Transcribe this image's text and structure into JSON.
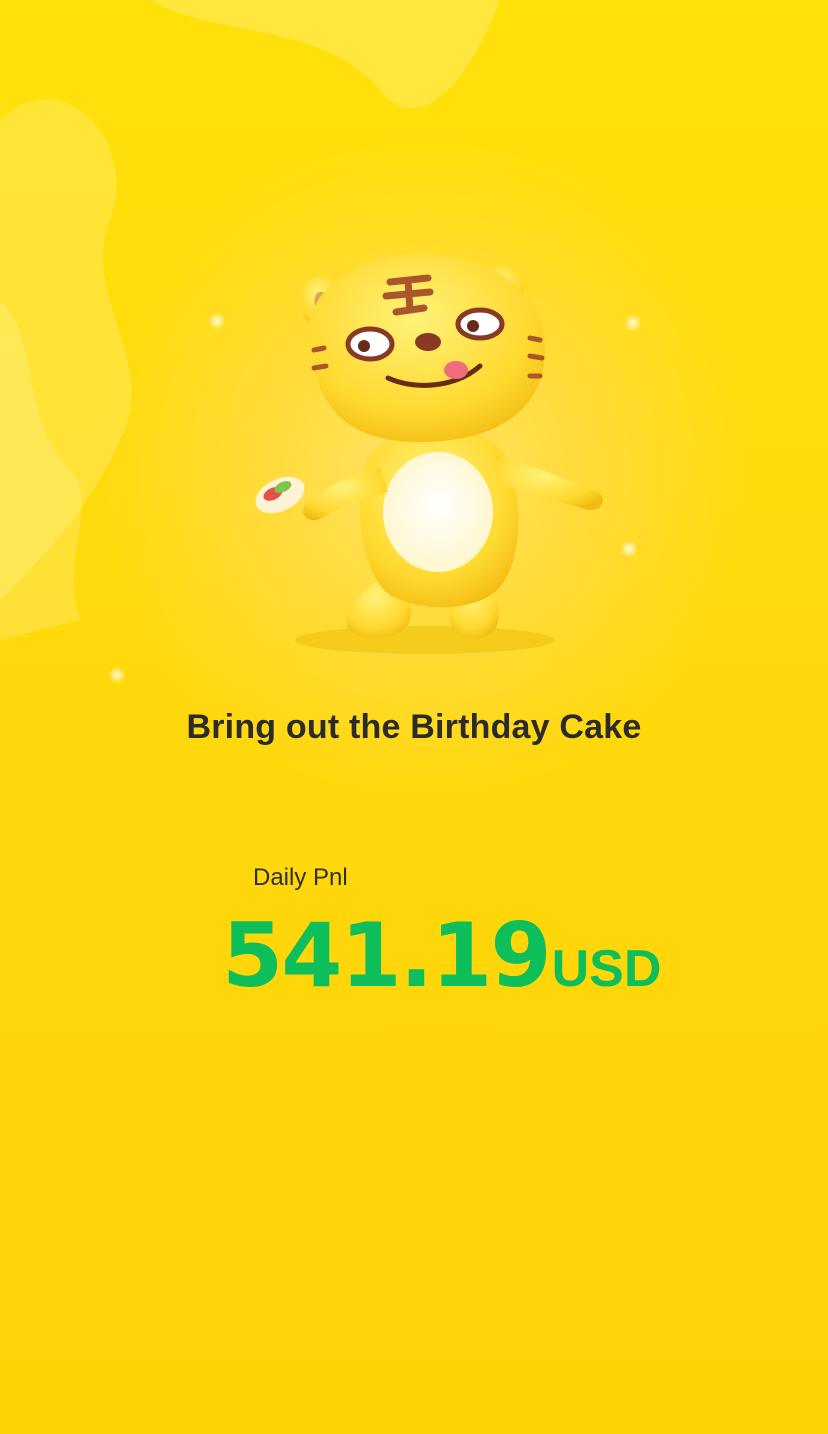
{
  "headline": "Bring out the Birthday Cake",
  "pnl": {
    "label": "Daily Pnl",
    "value": "541.19",
    "currency": "USD"
  },
  "colors": {
    "background": "#FFD80C",
    "headline_text": "#2B2B2B",
    "profit_green": "#0EBE5A"
  },
  "icons": {
    "mascot": "tiger-mascot-illustration"
  }
}
